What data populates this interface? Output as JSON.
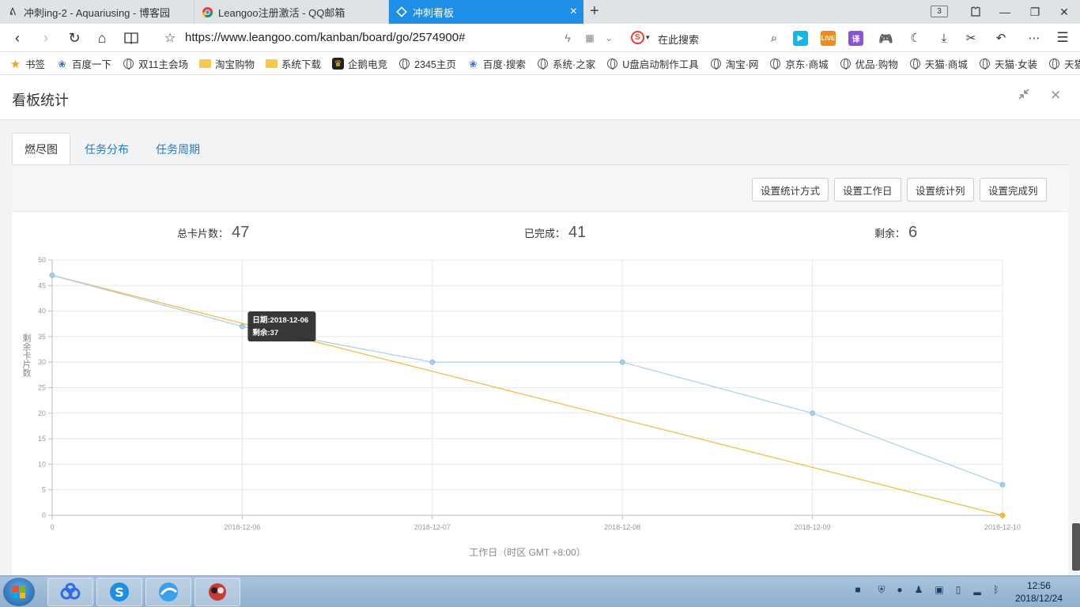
{
  "browser": {
    "tabs": [
      {
        "title": "冲刺ing-2 - Aquariusing - 博客园",
        "icon": "feather-icon"
      },
      {
        "title": "Leangoo注册激活 - QQ邮箱",
        "icon": "chrome-icon"
      },
      {
        "title": "冲刺看板",
        "icon": "leangoo-icon",
        "active": true
      }
    ],
    "tab_count": "3",
    "url": "https://www.leangoo.com/kanban/board/go/2574900#",
    "search_placeholder": "在此搜索",
    "ext_live": "LIVE",
    "ext_translate": "译"
  },
  "bookmarks": [
    {
      "label": "书签",
      "icon": "star-icon"
    },
    {
      "label": "百度一下",
      "icon": "baidu-paw-icon"
    },
    {
      "label": "双11主会场",
      "icon": "globe-icon"
    },
    {
      "label": "淘宝购物",
      "icon": "folder-icon"
    },
    {
      "label": "系统下载",
      "icon": "folder-icon"
    },
    {
      "label": "企鹅电竞",
      "icon": "penguin-esports-icon"
    },
    {
      "label": "2345主页",
      "icon": "globe-icon"
    },
    {
      "label": "百度·搜索",
      "icon": "baidu-paw-icon"
    },
    {
      "label": "系统·之家",
      "icon": "globe-icon"
    },
    {
      "label": "U盘启动制作工具",
      "icon": "globe-icon"
    },
    {
      "label": "淘宝·网",
      "icon": "globe-icon"
    },
    {
      "label": "京东·商城",
      "icon": "globe-icon"
    },
    {
      "label": "优品·购物",
      "icon": "globe-icon"
    },
    {
      "label": "天猫·商城",
      "icon": "globe-icon"
    },
    {
      "label": "天猫·女装",
      "icon": "globe-icon"
    },
    {
      "label": "天猫",
      "icon": "globe-icon"
    }
  ],
  "dialog": {
    "title": "看板统计",
    "tabs": [
      "燃尽图",
      "任务分布",
      "任务周期"
    ],
    "buttons": [
      "设置统计方式",
      "设置工作日",
      "设置统计列",
      "设置完成列"
    ],
    "stats": {
      "total_label": "总卡片数：",
      "total_value": "47",
      "done_label": "已完成：",
      "done_value": "41",
      "remain_label": "剩余：",
      "remain_value": "6"
    }
  },
  "chart_data": {
    "type": "line",
    "x": [
      "0",
      "2018-12-06",
      "2018-12-07",
      "2018-12-08",
      "2018-12-09",
      "2018-12-10"
    ],
    "series": [
      {
        "values": [
          47,
          37,
          30,
          30,
          20,
          6
        ],
        "color": "#a8cfe8"
      },
      {
        "values": [
          47,
          37.6,
          28.2,
          18.8,
          9.4,
          0
        ],
        "color": "#f0b93b"
      }
    ],
    "ylabel": "剩余卡片数",
    "xlabel": "工作日（时区 GMT +8:00）",
    "ylim": [
      0,
      50
    ],
    "yticks": [
      0,
      5,
      10,
      15,
      20,
      25,
      30,
      35,
      40,
      45,
      50
    ],
    "grid": true,
    "tooltip": {
      "line1": "日期:2018-12-06",
      "line2": "剩余:37"
    }
  },
  "taskbar": {
    "time": "12:56",
    "date": "2018/12/24"
  }
}
